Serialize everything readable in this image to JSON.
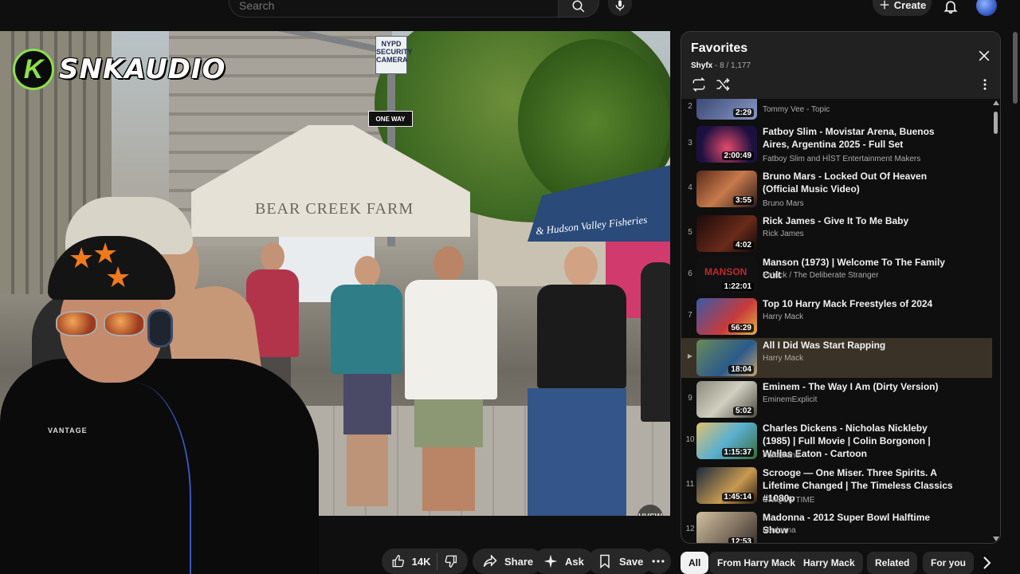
{
  "search": {
    "placeholder": "Search"
  },
  "header": {
    "create_label": "Create"
  },
  "video": {
    "channel_logo_text": "SNKAUDIO",
    "channel_logo_letter": "K",
    "tent_text": "BEAR CREEK FARM",
    "tent2_text": "& Hudson Valley Fisheries",
    "sign_nypd": "NYPD SECURITY CAMERA",
    "sign_oneway": "ONE WAY",
    "shirt_text": "VANTAGE",
    "watermark": "HVSW"
  },
  "actions": {
    "likes": "14K",
    "share": "Share",
    "ask": "Ask",
    "save": "Save"
  },
  "playlist": {
    "title": "Favorites",
    "owner": "Shyfx",
    "position": " - 8 / 1,177",
    "items": [
      {
        "index": "2",
        "title": "",
        "channel": "Tommy Vee - Topic",
        "duration": "2:29"
      },
      {
        "index": "3",
        "title": "Fatboy Slim - Movistar Arena, Buenos Aires, Argentina 2025 - Full Set",
        "channel": "Fatboy Slim and HÏST Entertainment Makers",
        "duration": "2:00:49"
      },
      {
        "index": "4",
        "title": "Bruno Mars - Locked Out Of Heaven (Official Music Video)",
        "channel": "Bruno Mars",
        "duration": "3:55"
      },
      {
        "index": "5",
        "title": "Rick James - Give It To Me Baby",
        "channel": "Rick James",
        "duration": "4:02"
      },
      {
        "index": "6",
        "title": "Manson (1973) | Welcome To The Family Cult",
        "channel": "Patrick / The Deliberate Stranger",
        "duration": "1:22:01"
      },
      {
        "index": "7",
        "title": "Top 10 Harry Mack Freestyles of 2024",
        "channel": "Harry Mack",
        "duration": "56:29"
      },
      {
        "index": "▶",
        "title": "All I Did Was Start Rapping",
        "channel": "Harry Mack",
        "duration": "18:04"
      },
      {
        "index": "9",
        "title": "Eminem - The Way I Am (Dirty Version)",
        "channel": "EminemExplicit",
        "duration": "5:02"
      },
      {
        "index": "10",
        "title": "Charles Dickens - Nicholas Nickleby (1985) | Full Movie | Colin Borgonon | Wallas Eaton - Cartoon",
        "channel": "FamBrand",
        "duration": "1:15:37"
      },
      {
        "index": "11",
        "title": "Scrooge — One Miser. Three Spirits. A Lifetime Changed | The Timeless Classics #1080p",
        "channel": "UNIQUE TIME",
        "duration": "1:45:14"
      },
      {
        "index": "12",
        "title": "Madonna - 2012 Super Bowl Halftime Show",
        "channel": "Madonna",
        "duration": "12:53"
      }
    ]
  },
  "chips": [
    "All",
    "From Harry Mack",
    "Harry Mack",
    "Related",
    "For you"
  ],
  "colors": {
    "background": "#0f0f0f",
    "panel_header": "#212121",
    "active_row": "#3a3226",
    "chip": "#272727",
    "logo_accent": "#8be14d"
  }
}
